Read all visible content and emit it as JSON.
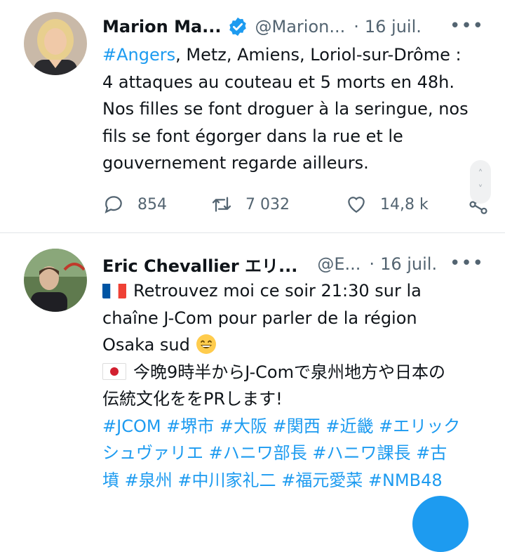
{
  "tweets": [
    {
      "author": "Marion Ma...",
      "handle": "@Marion...",
      "sep": "·",
      "date": "16 juil.",
      "more": "•••",
      "lines": [
        {
          "tag": "#Angers",
          "text": ", Metz, Amiens, Loriol-sur-Drôme :"
        },
        {
          "text": "4 attaques au couteau et 5 morts en 48h."
        },
        {
          "text": "Nos filles se font droguer à la seringue, nos"
        },
        {
          "text": "fils se font égorger dans la rue et le"
        },
        {
          "text": "gouvernement regarde ailleurs."
        }
      ],
      "replies": "854",
      "retweets": "7 032",
      "likes": "14,8 k"
    },
    {
      "author": "Eric Chevallier エリ...",
      "handle": "@E...",
      "sep": "·",
      "date": "16 juil.",
      "more": "•••",
      "line1": "Retrouvez moi ce soir 21:30 sur la",
      "line2": "chaîne J-Com pour parler de la région",
      "line3": "Osaka sud",
      "line4": "今晩9時半からJ-Comで泉州地方や日本の",
      "line5": "伝統文化ををPRします!",
      "tag_line1": "#JCOM #堺市 #大阪 #関西 #近畿 #エリック",
      "tag_line2": "シュヴァリエ #ハニワ部長 #ハニワ課長 #古",
      "tag_line3": "墳 #泉州 #中川家礼二 #福元愛菜 #NMB48"
    }
  ],
  "scroll": {
    "up": "˄",
    "down": "˅"
  },
  "colors": {
    "accent": "#1d9bf0",
    "secondary": "#536471",
    "divider": "#e1e5e8"
  },
  "icons": [
    "verified-badge-icon",
    "reply-icon",
    "retweet-icon",
    "like-icon",
    "share-icon",
    "more-icon",
    "flag-fr-icon",
    "flag-jp-icon",
    "smile-emoji-icon"
  ]
}
